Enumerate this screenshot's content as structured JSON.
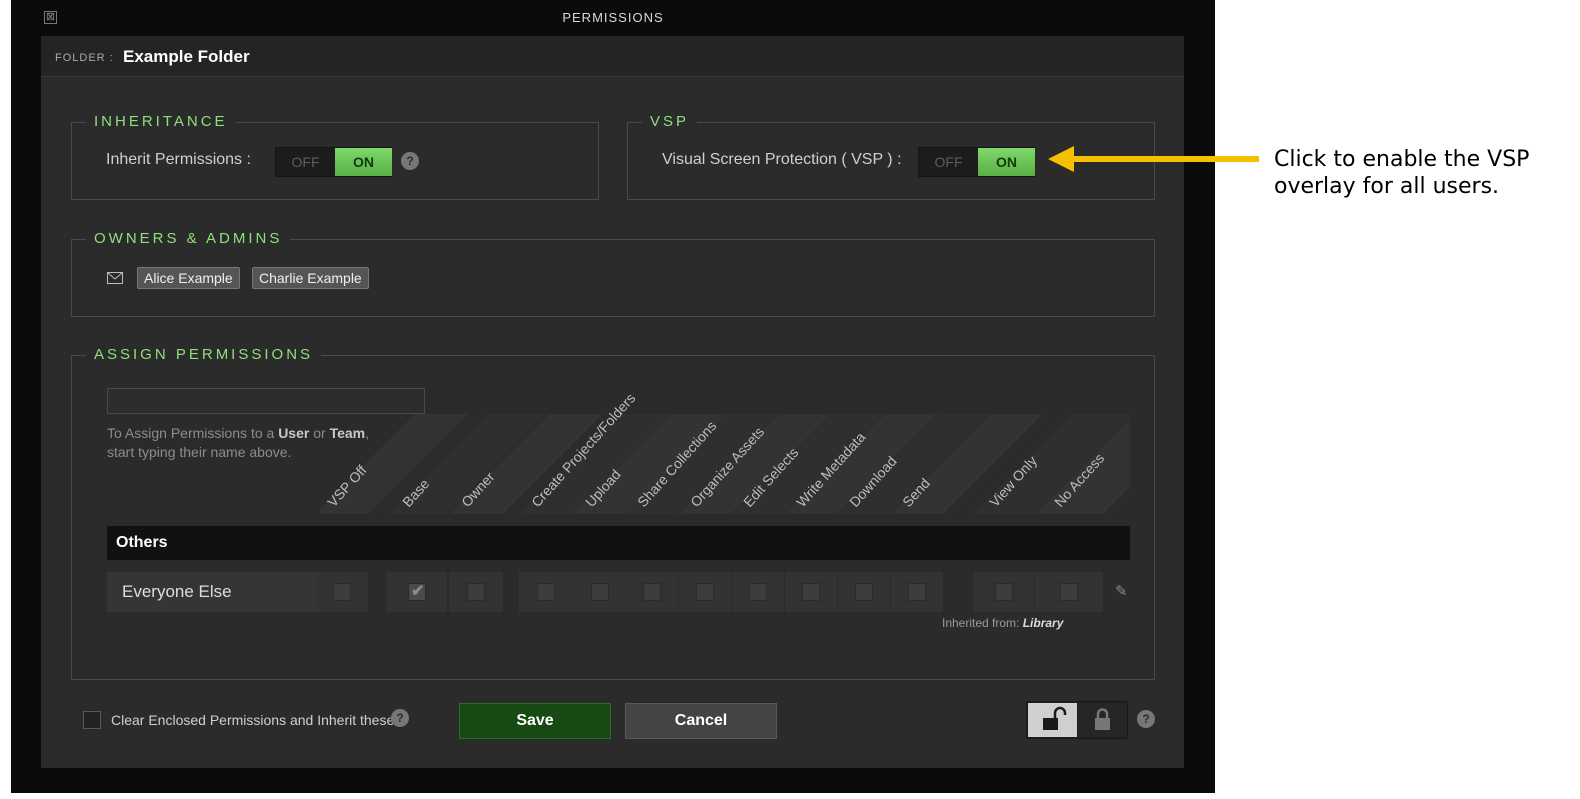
{
  "dialog": {
    "title": "PERMISSIONS",
    "close_glyph": "⊠"
  },
  "folder": {
    "label": "FOLDER :",
    "name": "Example Folder"
  },
  "inheritance": {
    "legend": "INHERITANCE",
    "label": "Inherit Permissions :",
    "toggle": {
      "off_label": "OFF",
      "on_label": "ON",
      "state": "on"
    },
    "help_glyph": "?"
  },
  "vsp": {
    "legend": "VSP",
    "label": "Visual Screen Protection ( VSP ) :",
    "toggle": {
      "off_label": "OFF",
      "on_label": "ON",
      "state": "on"
    }
  },
  "owners": {
    "legend": "OWNERS & ADMINS",
    "mail_icon": "envelope-icon",
    "chips": [
      "Alice Example",
      "Charlie Example"
    ]
  },
  "assign": {
    "legend": "ASSIGN PERMISSIONS",
    "search": {
      "value": "",
      "placeholder": ""
    },
    "hint_prefix": "To Assign Permissions to a ",
    "hint_user": "User",
    "hint_or": " or ",
    "hint_team": "Team",
    "hint_suffix": ",",
    "hint_line2": "start typing their name above.",
    "columns": [
      "VSP Off",
      "Base",
      "Owner",
      "Create Projects/Folders",
      "Upload",
      "Share Collections",
      "Organize Assets",
      "Edit Selects",
      "Write Metadata",
      "Download",
      "Send",
      "View Only",
      "No Access"
    ],
    "group_label": "Others",
    "rows": [
      {
        "name": "Everyone Else",
        "checked": [
          false,
          true,
          false,
          false,
          false,
          false,
          false,
          false,
          false,
          false,
          false,
          false,
          false
        ],
        "inherited_label": "Inherited from:",
        "inherited_source": "Library"
      }
    ],
    "edit_icon": "pencil-icon"
  },
  "footer": {
    "clear_label": "Clear Enclosed Permissions and Inherit these.",
    "help_glyph": "?",
    "save_label": "Save",
    "cancel_label": "Cancel",
    "unlock_icon": "unlock-icon",
    "lock_icon": "lock-icon"
  },
  "annotation": {
    "text": "Click to enable the VSP overlay for all users.",
    "arrow_color": "#f5c000"
  },
  "colors": {
    "accent_green": "#8fe07a",
    "toggle_on": "#6cc558",
    "save_green": "#164a12",
    "panel_bg": "#2b2b2b",
    "frame_bg": "#0b0b0b"
  }
}
